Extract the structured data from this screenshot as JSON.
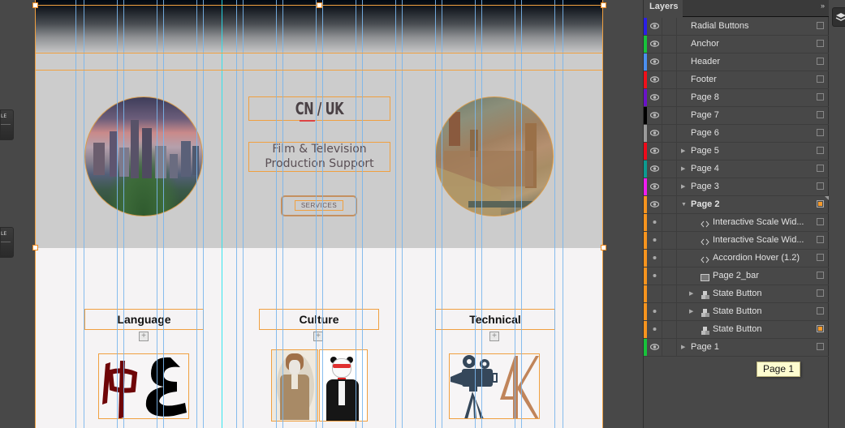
{
  "canvas": {
    "hero": {
      "title": "CN / UK",
      "subtitle_line1": "Film & Television",
      "subtitle_line2": "Production Support",
      "services_label": "SERVICES",
      "left_image": "beijing-skyline-image",
      "right_image": "london-westminster-image"
    },
    "sections": [
      {
        "label": "Language",
        "image": "chinese-arabic-characters-image"
      },
      {
        "label": "Culture",
        "image": "bulldog-panda-suits-image"
      },
      {
        "label": "Technical",
        "image": "camera-4k-image"
      }
    ],
    "plus_symbol": "+"
  },
  "left_gutter": {
    "mini_panel_label": "LE"
  },
  "layers_panel": {
    "tab_label": "Layers",
    "menu_icon": "»",
    "layers": [
      {
        "name": "Radial Buttons",
        "color": "#2a1ee6",
        "visible": true,
        "expander": "",
        "icon": "",
        "level": 0,
        "selected": false,
        "bold": false
      },
      {
        "name": "Anchor",
        "color": "#17c23a",
        "visible": true,
        "expander": "",
        "icon": "",
        "level": 0,
        "selected": false,
        "bold": false
      },
      {
        "name": "Header",
        "color": "#4b8ff0",
        "visible": true,
        "expander": "",
        "icon": "",
        "level": 0,
        "selected": false,
        "bold": false
      },
      {
        "name": "Footer",
        "color": "#f0101a",
        "visible": true,
        "expander": "",
        "icon": "",
        "level": 0,
        "selected": false,
        "bold": false
      },
      {
        "name": "Page 8",
        "color": "#6a12c8",
        "visible": true,
        "expander": "",
        "icon": "",
        "level": 0,
        "selected": false,
        "bold": false
      },
      {
        "name": "Page 7",
        "color": "#000000",
        "visible": true,
        "expander": "",
        "icon": "",
        "level": 0,
        "selected": false,
        "bold": false
      },
      {
        "name": "Page 6",
        "color": "#9a9a9a",
        "visible": true,
        "expander": "",
        "icon": "",
        "level": 0,
        "selected": false,
        "bold": false
      },
      {
        "name": "Page 5",
        "color": "#ee0a1a",
        "visible": true,
        "expander": "collapsed",
        "icon": "",
        "level": 0,
        "selected": false,
        "bold": false
      },
      {
        "name": "Page 4",
        "color": "#0c9a90",
        "visible": true,
        "expander": "collapsed",
        "icon": "",
        "level": 0,
        "selected": false,
        "bold": false
      },
      {
        "name": "Page 3",
        "color": "#f01cf0",
        "visible": true,
        "expander": "collapsed",
        "icon": "",
        "level": 0,
        "selected": false,
        "bold": false
      },
      {
        "name": "Page 2",
        "color": "#f7941e",
        "visible": true,
        "expander": "expanded",
        "icon": "",
        "level": 0,
        "selected": true,
        "bold": true
      },
      {
        "name": "Interactive Scale Wid...",
        "color": "#f7941e",
        "visible": "dot",
        "expander": "",
        "icon": "widget",
        "level": 1,
        "selected": false,
        "bold": false
      },
      {
        "name": "Interactive Scale Wid...",
        "color": "#f7941e",
        "visible": "dot",
        "expander": "",
        "icon": "widget",
        "level": 1,
        "selected": false,
        "bold": false
      },
      {
        "name": "Accordion Hover (1.2)",
        "color": "#f7941e",
        "visible": "dot",
        "expander": "",
        "icon": "widget",
        "level": 1,
        "selected": false,
        "bold": false
      },
      {
        "name": "Page 2_bar",
        "color": "#f7941e",
        "visible": "dot",
        "expander": "",
        "icon": "rectangle",
        "level": 1,
        "selected": false,
        "bold": false
      },
      {
        "name": "State Button",
        "color": "#f7941e",
        "visible": "none",
        "expander": "collapsed",
        "icon": "state-button",
        "level": 1,
        "selected": false,
        "bold": false
      },
      {
        "name": "State Button",
        "color": "#f7941e",
        "visible": "dot",
        "expander": "collapsed",
        "icon": "state-button",
        "level": 1,
        "selected": false,
        "bold": false
      },
      {
        "name": "State Button",
        "color": "#f7941e",
        "visible": "dot",
        "expander": "",
        "icon": "state-button",
        "level": 1,
        "selected": true,
        "bold": false
      },
      {
        "name": "Page 1",
        "color": "#17c23a",
        "visible": true,
        "expander": "collapsed",
        "icon": "",
        "level": 0,
        "selected": false,
        "bold": false
      }
    ],
    "tooltip": "Page 1"
  }
}
